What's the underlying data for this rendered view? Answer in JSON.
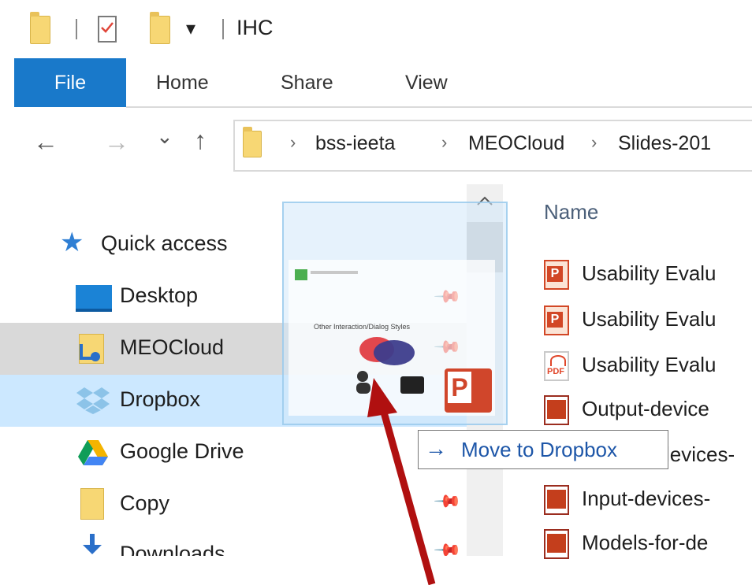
{
  "titlebar": {
    "title": "IHC",
    "dropdown_glyph": "▾"
  },
  "ribbon": {
    "tabs": [
      "File",
      "Home",
      "Share",
      "View"
    ],
    "accent": "#1979ca"
  },
  "nav": {
    "back": "←",
    "forward": "→",
    "recent": "⌄",
    "up": "↑",
    "breadcrumb": [
      "bss-ieeta",
      "MEOCloud",
      "Slides-201"
    ],
    "crumb_sep": "›"
  },
  "sidebar": {
    "items": [
      {
        "label": "Quick access",
        "icon": "star-icon"
      },
      {
        "label": "Desktop",
        "icon": "desktop-icon"
      },
      {
        "label": "MEOCloud",
        "icon": "meocloud-folder-icon"
      },
      {
        "label": "Dropbox",
        "icon": "dropbox-icon"
      },
      {
        "label": "Google Drive",
        "icon": "google-drive-icon"
      },
      {
        "label": "Copy",
        "icon": "folder-icon"
      },
      {
        "label": "Downloads",
        "icon": "download-icon"
      }
    ],
    "selected_color": "#d9d9d9",
    "hover_color": "#cce8ff"
  },
  "content": {
    "column_name": "Name",
    "files": [
      {
        "name": "Usability Evalu",
        "icon": "pptx-icon"
      },
      {
        "name": "Usability Evalu",
        "icon": "pptx-icon"
      },
      {
        "name": "Usability Evalu",
        "icon": "pdf-icon"
      },
      {
        "name": "Output-device",
        "icon": "ppt-icon"
      },
      {
        "name": "levices-",
        "icon": "ppt-icon"
      },
      {
        "name": "Input-devices-",
        "icon": "ppt-icon"
      },
      {
        "name": "Models-for-de",
        "icon": "ppt-icon"
      }
    ]
  },
  "drag": {
    "slide_title": "Other Interaction/Dialog Styles",
    "tooltip": "Move to Dropbox",
    "tooltip_arrow": "→"
  }
}
